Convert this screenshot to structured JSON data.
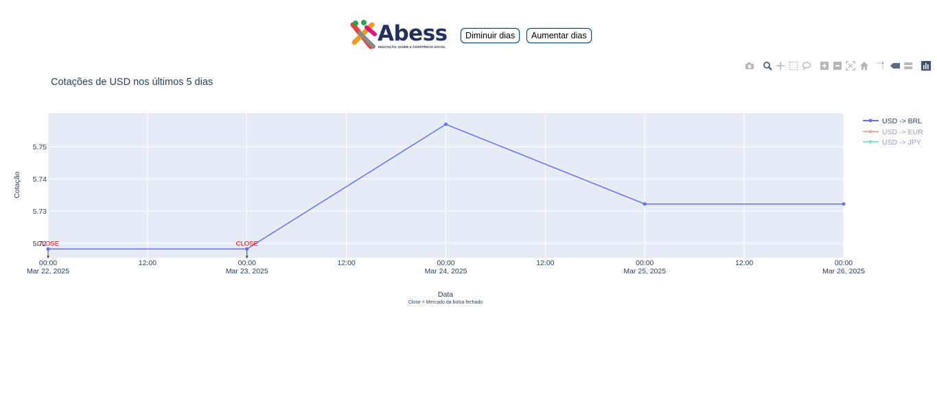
{
  "header": {
    "logo_text": "Abess",
    "logo_tagline": "EDUCAÇÃO, SAÚDE & ASSISTÊNCIA SOCIAL",
    "decrease_button": "Diminuir dias",
    "increase_button": "Aumentar dias"
  },
  "modebar_icons": [
    "camera-icon",
    "zoom-icon",
    "pan-icon",
    "box-select-icon",
    "lasso-select-icon",
    "zoom-in-icon",
    "zoom-out-icon",
    "autoscale-icon",
    "reset-axes-icon",
    "spike-lines-icon",
    "hover-closest-icon",
    "hover-compare-icon",
    "plotly-logo-icon"
  ],
  "chart_data": {
    "type": "line",
    "title": "Cotações de USD nos últimos 5 dias",
    "xlabel": "Data",
    "x_note": "Close = Mercado da bolsa fechado",
    "ylabel": "Cotação",
    "x": [
      "2025-03-22 00:00",
      "2025-03-23 00:00",
      "2025-03-24 00:00",
      "2025-03-25 00:00",
      "2025-03-26 00:00"
    ],
    "xlim": [
      "2025-03-22 00:00",
      "2025-03-26 00:00"
    ],
    "x_ticks": [
      {
        "time": "00:00",
        "date": "Mar 22, 2025"
      },
      {
        "time": "12:00",
        "date": ""
      },
      {
        "time": "00:00",
        "date": "Mar 23, 2025"
      },
      {
        "time": "12:00",
        "date": ""
      },
      {
        "time": "00:00",
        "date": "Mar 24, 2025"
      },
      {
        "time": "12:00",
        "date": ""
      },
      {
        "time": "00:00",
        "date": "Mar 25, 2025"
      },
      {
        "time": "12:00",
        "date": ""
      },
      {
        "time": "00:00",
        "date": "Mar 26, 2025"
      }
    ],
    "y_ticks": [
      "5.72",
      "5.73",
      "5.74",
      "5.75"
    ],
    "ylim": [
      5.7155,
      5.7605
    ],
    "grid": true,
    "legend_position": "right",
    "series": [
      {
        "name": "USD -> BRL",
        "color": "#636efa",
        "visible": true,
        "values": [
          5.7182,
          5.7182,
          5.757,
          5.7322,
          5.7322
        ]
      },
      {
        "name": "USD -> EUR",
        "color": "#ef553b",
        "visible": false,
        "values": []
      },
      {
        "name": "USD -> JPY",
        "color": "#00cc96",
        "visible": false,
        "values": []
      }
    ],
    "annotations": [
      {
        "text": "CLOSE",
        "x": "2025-03-22 00:00",
        "y": 5.7182,
        "color": "#ee0000"
      },
      {
        "text": "CLOSE",
        "x": "2025-03-23 00:00",
        "y": 5.7182,
        "color": "#ee0000"
      }
    ]
  }
}
